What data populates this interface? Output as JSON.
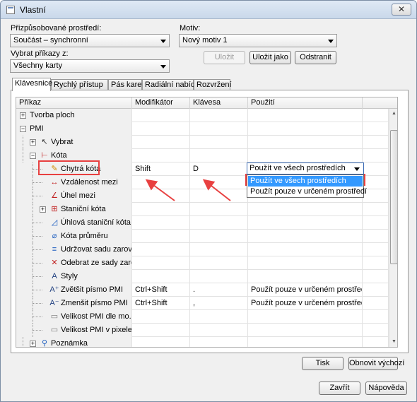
{
  "window": {
    "title": "Vlastní",
    "close_glyph": "✕"
  },
  "env": {
    "label": "Přizpůsobované prostředí:",
    "value": "Součást – synchronní"
  },
  "motiv": {
    "label": "Motiv:",
    "value": "Nový motiv 1"
  },
  "commands_select": {
    "label": "Vybrat příkazy z:",
    "value": "Všechny karty"
  },
  "buttons": {
    "save": "Uložit",
    "save_as": "Uložit jako",
    "remove": "Odstranit",
    "print": "Tisk",
    "restore": "Obnovit výchozí",
    "close": "Zavřít",
    "help": "Nápověda"
  },
  "tabs": [
    "Klávesnice",
    "Rychlý přístup",
    "Pás karet",
    "Radiální nabídka",
    "Rozvržení"
  ],
  "grid": {
    "columns": [
      "Příkaz",
      "Modifikátor",
      "Klávesa",
      "Použití"
    ],
    "rows": [
      {
        "command": "Tvorba ploch",
        "modifier": "",
        "key": "",
        "usage": "",
        "icon": ""
      },
      {
        "command": "PMI",
        "modifier": "",
        "key": "",
        "usage": "",
        "icon": ""
      },
      {
        "command": "Vybrat",
        "modifier": "",
        "key": "",
        "usage": "",
        "icon": "select-arrow-icon"
      },
      {
        "command": "Kóta",
        "modifier": "",
        "key": "",
        "usage": "",
        "icon": "dimension-icon"
      },
      {
        "command": "Chytrá kóta",
        "modifier": "Shift",
        "key": "D",
        "usage": "Použít ve všech prostředích",
        "icon": "smart-dimension-icon"
      },
      {
        "command": "Vzdálenost mezi",
        "modifier": "",
        "key": "",
        "usage": "",
        "icon": "distance-between-icon"
      },
      {
        "command": "Úhel mezi",
        "modifier": "",
        "key": "",
        "usage": "",
        "icon": "angle-between-icon"
      },
      {
        "command": "Staniční kóta",
        "modifier": "",
        "key": "",
        "usage": "",
        "icon": "coordinate-dimension-icon"
      },
      {
        "command": "Úhlová staniční kóta",
        "modifier": "",
        "key": "",
        "usage": "",
        "icon": "angular-coordinate-icon"
      },
      {
        "command": "Kóta průměru",
        "modifier": "",
        "key": "",
        "usage": "",
        "icon": "diameter-icon"
      },
      {
        "command": "Udržovat sadu zarov...",
        "modifier": "",
        "key": "",
        "usage": "",
        "icon": "alignment-set-icon"
      },
      {
        "command": "Odebrat ze sady zaro...",
        "modifier": "",
        "key": "",
        "usage": "",
        "icon": "remove-alignment-icon"
      },
      {
        "command": "Styly",
        "modifier": "",
        "key": "",
        "usage": "",
        "icon": "styles-icon"
      },
      {
        "command": "Zvětšit písmo PMI",
        "modifier": "Ctrl+Shift",
        "key": ".",
        "usage": "Použít pouze v určeném prostředí",
        "icon": "font-increase-icon"
      },
      {
        "command": "Zmenšit písmo PMI",
        "modifier": "Ctrl+Shift",
        "key": ",",
        "usage": "Použít pouze v určeném prostředí",
        "icon": "font-decrease-icon"
      },
      {
        "command": "Velikost PMI dle mo...",
        "modifier": "",
        "key": "",
        "usage": "",
        "icon": "document-icon"
      },
      {
        "command": "Velikost PMI v pixelech",
        "modifier": "",
        "key": "",
        "usage": "",
        "icon": "document-icon"
      },
      {
        "command": "Poznámka",
        "modifier": "",
        "key": "",
        "usage": "",
        "icon": "note-icon"
      }
    ]
  },
  "usage_dropdown": {
    "options": [
      "Použít ve všech prostředích",
      "Použít pouze v určeném prostředí"
    ],
    "selected_index": 0
  },
  "colors": {
    "annotation_red": "#e84040",
    "selection_blue": "#3399ff"
  }
}
